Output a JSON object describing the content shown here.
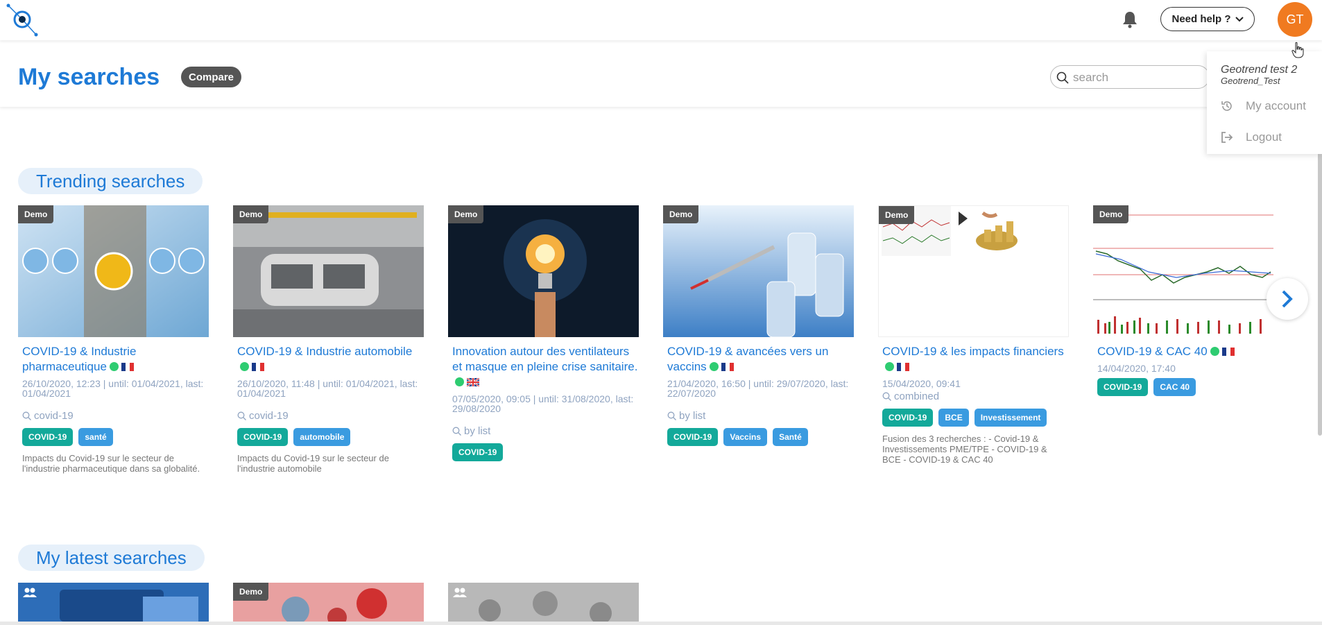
{
  "app": {
    "logo_icon": "geotrend-logo",
    "accent": "#1e7ad6"
  },
  "topbar": {
    "help_label": "Need help ?",
    "avatar_initials": "GT",
    "avatar_color": "#f07a20"
  },
  "header": {
    "title": "My searches",
    "compare_label": "Compare",
    "search_placeholder": "search"
  },
  "user_menu": {
    "name": "Geotrend test 2",
    "org": "Geotrend_Test",
    "items": [
      {
        "label": "My account",
        "icon": "history-icon"
      },
      {
        "label": "Logout",
        "icon": "logout-icon"
      }
    ]
  },
  "sections": {
    "trending": "Trending searches",
    "latest": "My latest searches"
  },
  "demo_label": "Demo",
  "trending_cards": [
    {
      "title": "COVID-19 & Industrie pharmaceutique",
      "flag": "fr",
      "date": "26/10/2020, 12:23 | until: 01/04/2021, last: 01/04/2021",
      "query": "covid-19",
      "tags": [
        "COVID-19",
        "santé"
      ],
      "description": "Impacts du Covid-19 sur le secteur de l'industrie pharmaceutique dans sa globalité."
    },
    {
      "title": "COVID-19 & Industrie automobile",
      "flag": "fr",
      "date": "26/10/2020, 11:48 | until: 01/04/2021, last: 01/04/2021",
      "query": "covid-19",
      "tags": [
        "COVID-19",
        "automobile"
      ],
      "description": "Impacts du Covid-19 sur le secteur de l'industrie automobile"
    },
    {
      "title": "Innovation autour des ventilateurs et masque en pleine crise sanitaire.",
      "flag": "gb",
      "date": "07/05/2020, 09:05 | until: 31/08/2020, last: 29/08/2020",
      "query": "by list",
      "tags": [
        "COVID-19"
      ],
      "description": ""
    },
    {
      "title": "COVID-19 & avancées vers un vaccins",
      "flag": "fr",
      "date": "21/04/2020, 16:50 | until: 29/07/2020, last: 22/07/2020",
      "query": "by list",
      "tags": [
        "COVID-19",
        "Vaccins",
        "Santé"
      ],
      "description": ""
    },
    {
      "title": "COVID-19 & les impacts financiers",
      "flag": "fr",
      "date": "15/04/2020, 09:41",
      "query": "combined",
      "tags": [
        "COVID-19",
        "BCE",
        "Investissement"
      ],
      "description": "Fusion des 3 recherches : - Covid-19 & Investissements PME/TPE - COVID-19 & BCE - COVID-19 & CAC 40"
    },
    {
      "title": "COVID-19 & CAC 40",
      "flag": "fr",
      "date": "14/04/2020, 17:40",
      "query": "",
      "tags": [
        "COVID-19",
        "CAC 40"
      ],
      "description": ""
    }
  ]
}
